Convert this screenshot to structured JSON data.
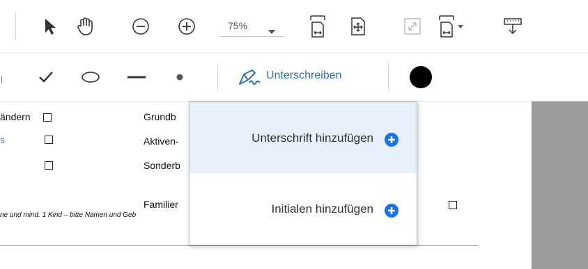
{
  "toolbar": {
    "zoom": "75%"
  },
  "sign_toolbar": {
    "sign_label": "Unterschreiben",
    "ink_color": "#000000"
  },
  "document": {
    "left_labels": [
      "ändern",
      "s"
    ],
    "mid_labels": [
      "Grundb",
      "Aktiven-",
      "Sonderb",
      "Familier"
    ],
    "footnote": "ne und mind. 1 Kind – bitte Namen und Geb"
  },
  "dropdown": {
    "items": [
      {
        "label": "Unterschrift hinzufügen"
      },
      {
        "label": "Initialen hinzufügen"
      }
    ]
  },
  "colors": {
    "accent": "#2d6fbd",
    "plus_icon": "#1a73e8",
    "hover": "#e8f1fb",
    "gutter": "#9b9b9b"
  }
}
